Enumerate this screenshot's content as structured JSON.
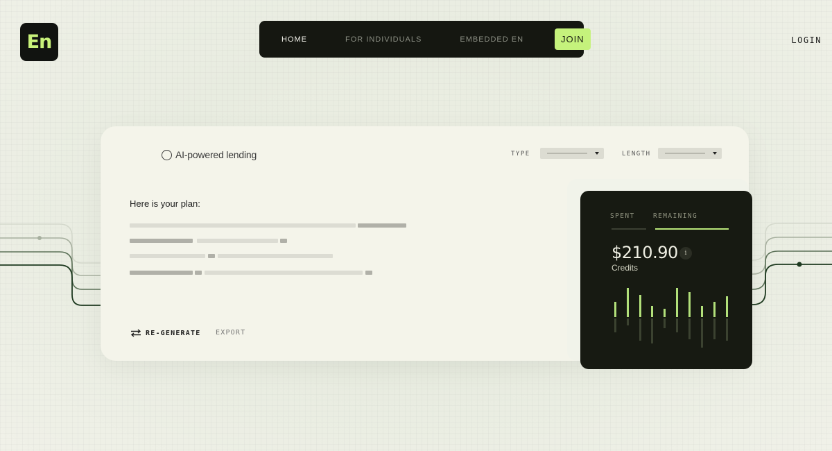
{
  "logo": {
    "text": "En"
  },
  "nav": {
    "items": [
      {
        "label": "HOME",
        "active": true
      },
      {
        "label": "FOR INDIVIDUALS",
        "active": false
      },
      {
        "label": "EMBEDDED EN",
        "active": false
      }
    ],
    "join_label": "JOIN"
  },
  "login_label": "LOGIN",
  "card": {
    "title": "AI-powered lending",
    "filters": {
      "type_label": "TYPE",
      "length_label": "LENGTH"
    },
    "plan_title": "Here is your plan:",
    "regenerate_label": "RE-GENERATE",
    "export_label": "EXPORT"
  },
  "panel": {
    "tabs": [
      {
        "label": "SPENT",
        "active": false
      },
      {
        "label": "REMAINING",
        "active": true
      }
    ],
    "amount": "$210.90",
    "info_icon": "i",
    "sub_label": "Credits"
  },
  "colors": {
    "accent": "#c5f27c",
    "dark": "#151711",
    "card_bg": "#f4f4ea"
  }
}
